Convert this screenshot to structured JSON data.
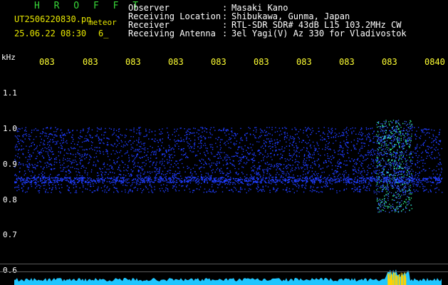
{
  "header": {
    "logo": "H R O F F T",
    "file_name": "UT2506220830.pn",
    "meteor_label": "meteor",
    "date_time": "25.06.22 08:30",
    "count": "6_"
  },
  "station": [
    {
      "label": "Observer",
      "value": "Masaki Kano"
    },
    {
      "label": "Receiving Location",
      "value": "Shibukawa, Gunma, Japan"
    },
    {
      "label": "Receiver",
      "value": "RTL-SDR SDR# 43dB L15 103.2MHz CW"
    },
    {
      "label": "Receiving Antenna",
      "value": "3el Yagi(V) Az 330 for Vladivostok"
    }
  ],
  "axis": {
    "unit": "kHz",
    "x_ticks": [
      "083",
      "083",
      "083",
      "083",
      "083",
      "083",
      "083",
      "083",
      "083",
      "0840"
    ],
    "y_ticks": [
      "1.1",
      "1.0",
      "0.9",
      "0.8",
      "0.7",
      "0.6"
    ]
  },
  "colors": {
    "signal": "#1f3cff",
    "bright": "#33ff99",
    "baseline": "#1fc6ff"
  }
}
